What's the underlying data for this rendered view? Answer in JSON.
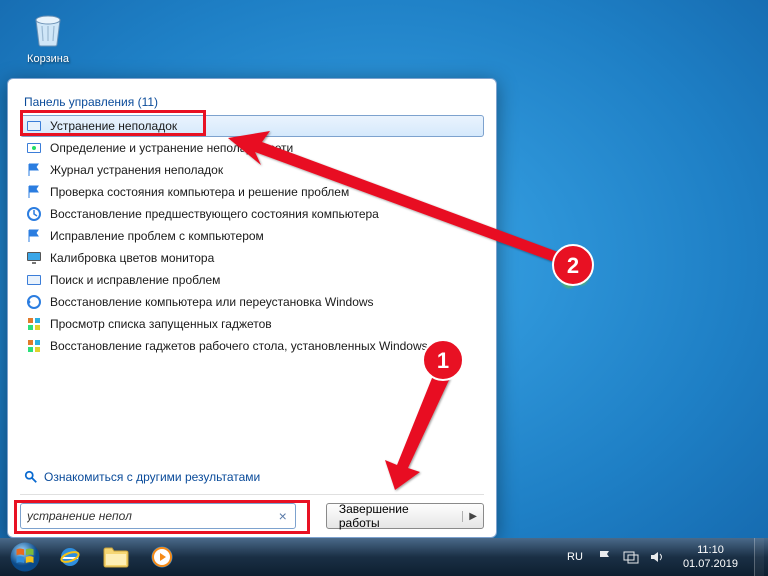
{
  "desktop": {
    "recycle_bin_label": "Корзина"
  },
  "start_menu": {
    "header": "Панель управления (11)",
    "items": [
      "Устранение неполадок",
      "Определение и устранение неполадок сети",
      "Журнал устранения неполадок",
      "Проверка состояния компьютера и решение проблем",
      "Восстановление предшествующего состояния компьютера",
      "Исправление проблем с компьютером",
      "Калибровка цветов монитора",
      "Поиск и исправление проблем",
      "Восстановление компьютера или переустановка Windows",
      "Просмотр списка запущенных гаджетов",
      "Восстановление гаджетов рабочего стола, установленных Windows"
    ],
    "more_results": "Ознакомиться с другими результатами",
    "search_value": "устранение непол",
    "shutdown_label": "Завершение работы"
  },
  "annotations": {
    "badge1": "1",
    "badge2": "2"
  },
  "taskbar": {
    "lang": "RU",
    "time": "11:10",
    "date": "01.07.2019"
  }
}
